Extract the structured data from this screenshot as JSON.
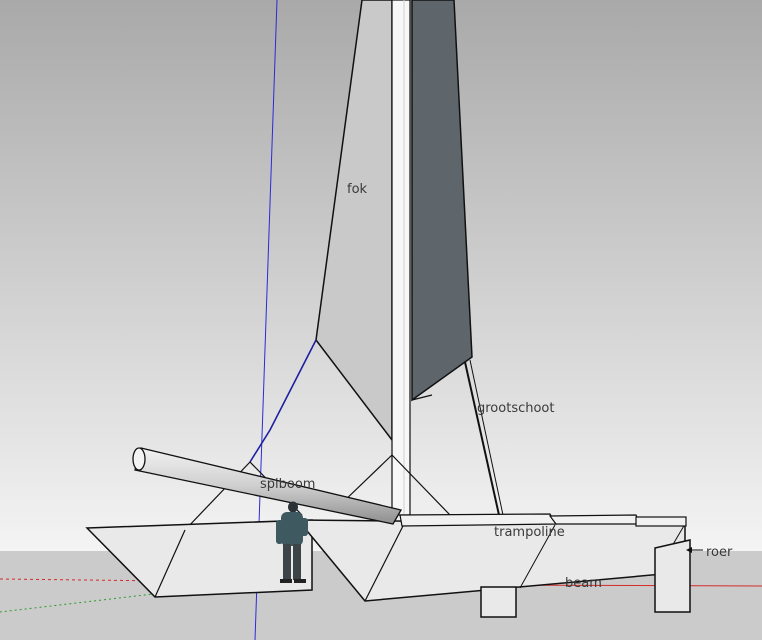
{
  "scene": {
    "labels": {
      "fok": "fok",
      "grootschoot": "grootschoot",
      "spiboom": "spiboom",
      "trampoline": "trampoline",
      "roer": "roer",
      "beam": "beam"
    },
    "colors": {
      "sky_top": "#a9a9a9",
      "sky_bottom": "#f4f4f4",
      "ground": "#cbcbcb",
      "jib_fill": "#c9c9c9",
      "mainsail_fill": "#5f666b",
      "hull_fill": "#e9e9e9",
      "blue_axis": "#2b2bd6",
      "red_axis": "#d42a2a",
      "green_axis": "#2c9a2c",
      "outline": "#111111"
    }
  }
}
